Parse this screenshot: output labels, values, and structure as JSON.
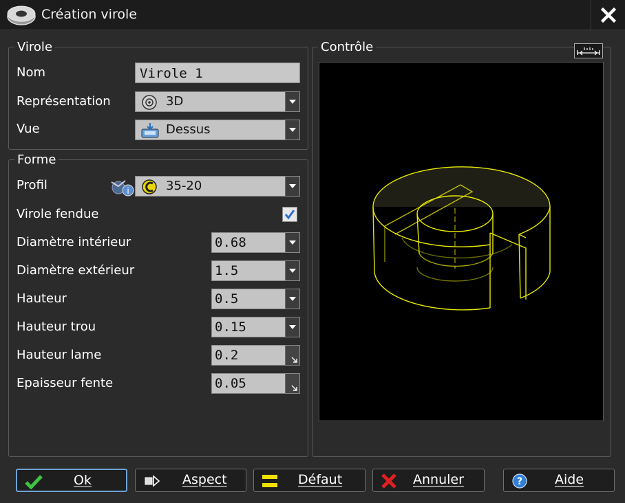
{
  "window": {
    "title": "Création virole"
  },
  "virole_group": {
    "legend": "Virole",
    "nom_label": "Nom",
    "nom_value": "Virole 1",
    "representation_label": "Représentation",
    "representation_value": "3D",
    "vue_label": "Vue",
    "vue_value": "Dessus"
  },
  "forme_group": {
    "legend": "Forme",
    "profil_label": "Profil",
    "profil_value": "35-20",
    "fendue_label": "Virole fendue",
    "fendue_checked": true,
    "diam_int_label": "Diamètre intérieur",
    "diam_int_value": "0.68",
    "diam_ext_label": "Diamètre extérieur",
    "diam_ext_value": "1.5",
    "hauteur_label": "Hauteur",
    "hauteur_value": "0.5",
    "hauteur_trou_label": "Hauteur trou",
    "hauteur_trou_value": "0.15",
    "hauteur_lame_label": "Hauteur lame",
    "hauteur_lame_value": "0.2",
    "epaisseur_label": "Epaisseur fente",
    "epaisseur_value": "0.05"
  },
  "controle_group": {
    "legend": "Contrôle"
  },
  "buttons": {
    "ok": "Ok",
    "aspect": "Aspect",
    "defaut": "Défaut",
    "annuler": "Annuler",
    "aide": "Aide"
  },
  "colors": {
    "wireframe": "#e8e800",
    "focus_border": "#6fa2d6",
    "panel_bg": "#2b2b2b"
  }
}
